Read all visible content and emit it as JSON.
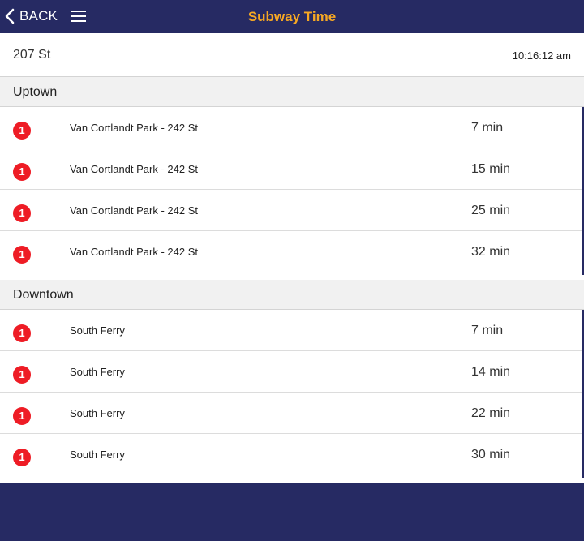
{
  "header": {
    "back_label": "BACK",
    "title": "Subway Time",
    "title_color": "#f7a823",
    "bar_color": "#262a63",
    "back_icon": "chevron-left-icon",
    "menu_icon": "hamburger-menu-icon"
  },
  "station": {
    "name": "207 St",
    "time": "10:16:12 am"
  },
  "sections": [
    {
      "label": "Uptown",
      "trains": [
        {
          "line": "1",
          "destination": "Van Cortlandt Park - 242 St",
          "eta": "7 min"
        },
        {
          "line": "1",
          "destination": "Van Cortlandt Park - 242 St",
          "eta": "15 min"
        },
        {
          "line": "1",
          "destination": "Van Cortlandt Park - 242 St",
          "eta": "25 min"
        },
        {
          "line": "1",
          "destination": "Van Cortlandt Park - 242 St",
          "eta": "32 min"
        }
      ]
    },
    {
      "label": "Downtown",
      "trains": [
        {
          "line": "1",
          "destination": "South Ferry",
          "eta": "7 min"
        },
        {
          "line": "1",
          "destination": "South Ferry",
          "eta": "14 min"
        },
        {
          "line": "1",
          "destination": "South Ferry",
          "eta": "22 min"
        },
        {
          "line": "1",
          "destination": "South Ferry",
          "eta": "30 min"
        }
      ]
    }
  ],
  "line_color": "#ee1c25"
}
